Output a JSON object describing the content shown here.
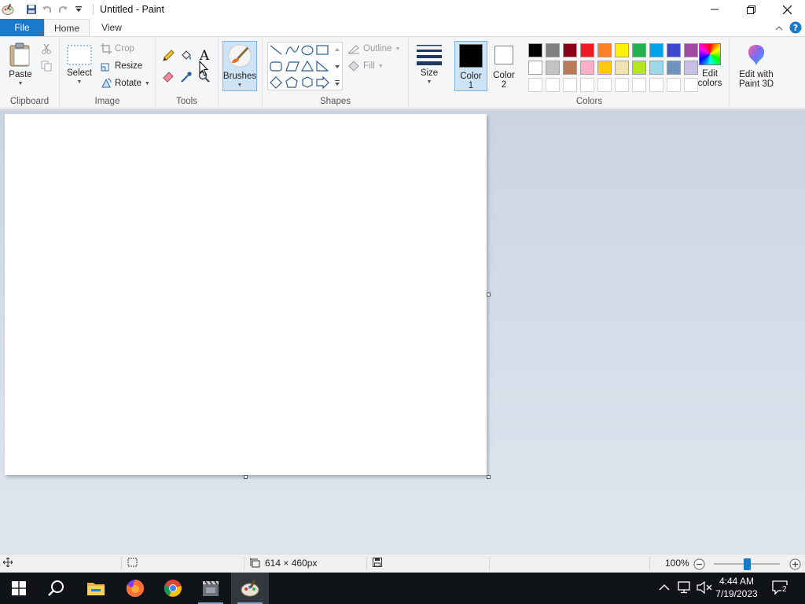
{
  "window": {
    "title": "Untitled - Paint"
  },
  "tabs": {
    "file": "File",
    "home": "Home",
    "view": "View"
  },
  "clipboard": {
    "paste": "Paste",
    "label": "Clipboard"
  },
  "image": {
    "select": "Select",
    "crop": "Crop",
    "resize": "Resize",
    "rotate": "Rotate",
    "label": "Image"
  },
  "tools": {
    "label": "Tools"
  },
  "brushes": {
    "label": "Brushes"
  },
  "shapes": {
    "outline": "Outline",
    "fill": "Fill",
    "label": "Shapes"
  },
  "size": {
    "label": "Size"
  },
  "colors": {
    "color1": "Color",
    "color1_num": "1",
    "color2": "Color",
    "color2_num": "2",
    "label": "Colors",
    "edit_colors_1": "Edit",
    "edit_colors_2": "colors",
    "paint3d_1": "Edit with",
    "paint3d_2": "Paint 3D",
    "color1_value": "#000000",
    "color2_value": "#ffffff",
    "palette_row1": [
      "#000000",
      "#7f7f7f",
      "#880015",
      "#ed1c24",
      "#ff7f27",
      "#fff200",
      "#22b14c",
      "#00a2e8",
      "#3f48cc",
      "#a349a4"
    ],
    "palette_row2": [
      "#ffffff",
      "#c3c3c3",
      "#b97a57",
      "#ffaec9",
      "#ffc90e",
      "#efe4b0",
      "#b5e61d",
      "#99d9ea",
      "#7092be",
      "#c8bfe7"
    ]
  },
  "status": {
    "canvas_size": "614 × 460px",
    "zoom": "100%",
    "zoom_level": 0.5
  },
  "taskbar": {
    "time": "4:44 AM",
    "date": "7/19/2023",
    "notifications": "2"
  }
}
